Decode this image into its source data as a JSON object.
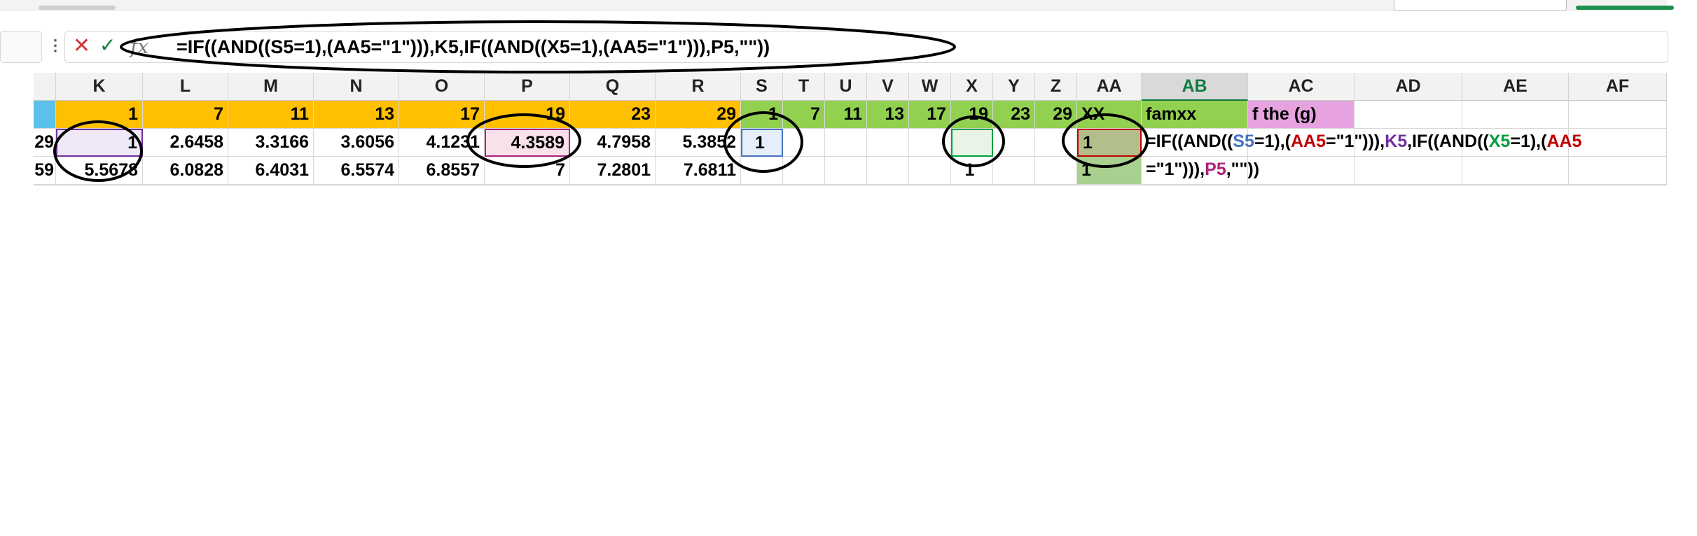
{
  "formula_bar": {
    "formula": "=IF((AND((S5=1),(AA5=\"1\"))),K5,IF((AND((X5=1),(AA5=\"1\"))),P5,\"\"))",
    "cancel_icon": "close-icon",
    "confirm_icon": "check-icon",
    "fx_label": "fx"
  },
  "columns": [
    "K",
    "L",
    "M",
    "N",
    "O",
    "P",
    "Q",
    "R",
    "S",
    "T",
    "U",
    "V",
    "W",
    "X",
    "Y",
    "Z",
    "AA",
    "AB",
    "AC",
    "AD",
    "AE",
    "AF"
  ],
  "selected_column": "AB",
  "rows": {
    "row4": {
      "left_partial": "",
      "K": "1",
      "L": "7",
      "M": "11",
      "N": "13",
      "O": "17",
      "P": "19",
      "Q": "23",
      "R": "29",
      "S": "1",
      "T": "7",
      "U": "11",
      "V": "13",
      "W": "17",
      "X": "19",
      "Y": "23",
      "Z": "29",
      "AA": "XX",
      "AB": "famxx",
      "AC": "f the (g)"
    },
    "row5": {
      "left_partial": "29",
      "K": "1",
      "L": "2.6458",
      "M": "3.3166",
      "N": "3.6056",
      "O": "4.1231",
      "P": "4.3589",
      "Q": "4.7958",
      "R": "5.3852",
      "S": "1",
      "AA": "1"
    },
    "row6": {
      "left_partial": "59",
      "K": "5.5678",
      "L": "6.0828",
      "M": "6.4031",
      "N": "6.5574",
      "O": "6.8557",
      "P": "7",
      "Q": "7.2801",
      "R": "7.6811",
      "X": "1",
      "AA": "1"
    }
  },
  "cell_formula": {
    "p1": "=IF((AND((",
    "p2": "S5",
    "p3": "=1),(",
    "p4": "AA5",
    "p5": "=\"1\"))),",
    "p6": "K5",
    "p7": ",IF((AND((",
    "p8": "X5",
    "p9": "=1),(",
    "p10": "AA5",
    "p11": "=\"1\"))),",
    "p12": "P5",
    "p13": ",\"\"))"
  },
  "colors": {
    "orange": "#ffc000",
    "green": "#92d050",
    "pink": "#e6a3e0",
    "excel_green": "#107c41",
    "ref_blue": "#4472c4",
    "ref_red": "#c00000",
    "ref_purple": "#7030a0",
    "ref_green": "#00a040",
    "ref_magenta": "#b0207a"
  }
}
